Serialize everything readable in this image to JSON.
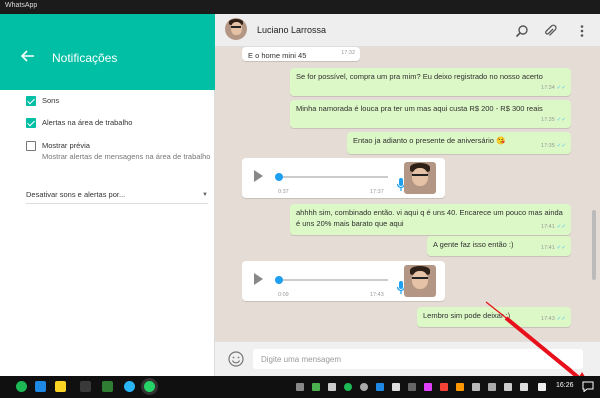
{
  "window": {
    "title": "WhatsApp"
  },
  "settings": {
    "title": "Notificações",
    "options": [
      {
        "label": "Sons",
        "checked": true
      },
      {
        "label": "Alertas na área de trabalho",
        "checked": true
      },
      {
        "label": "Mostrar prévia",
        "description": "Mostrar alertas de mensagens na área de trabalho",
        "checked": false
      }
    ],
    "dropdown_label": "Desativar sons e alertas por...",
    "dropdown_caret": "▼"
  },
  "chat": {
    "contact_name": "Luciano Larrossa",
    "messages": [
      {
        "dir": "in",
        "text": "E o home mini 45",
        "time": "17:32"
      },
      {
        "dir": "out",
        "text": "Se for possível, compra um pra mim? Eu deixo registrado no nosso acerto",
        "time": "17:34"
      },
      {
        "dir": "out",
        "text": "Minha namorada é louca pra ter um mas aqui custa R$ 200 - R$ 300 reais",
        "time": "17:35"
      },
      {
        "dir": "out",
        "text": "Entao ja adianto o presente de aniversário 😘",
        "time": "17:35"
      },
      {
        "dir": "voice",
        "duration": "0:37",
        "time": "17:37"
      },
      {
        "dir": "out",
        "text": "ahhhh sim, combinado então. vi aqui q é uns 40. Encarece um pouco mas ainda é uns 20% mais barato que aqui",
        "time": "17:41"
      },
      {
        "dir": "out",
        "text": "A gente faz isso então :)",
        "time": "17:41"
      },
      {
        "dir": "voice",
        "duration": "0:09",
        "time": "17:43"
      },
      {
        "dir": "out",
        "text": "Lembro sim pode deixar :)",
        "time": "17:43"
      }
    ],
    "ticks": "✓✓"
  },
  "composer": {
    "placeholder": "Digite uma mensagem"
  },
  "taskbar": {
    "clock": "16:26"
  },
  "colors": {
    "accent": "#00bfa5",
    "outgoing": "#dcf8c6",
    "chat_bg": "#e5ddd5",
    "arrow": "#e8101a"
  }
}
